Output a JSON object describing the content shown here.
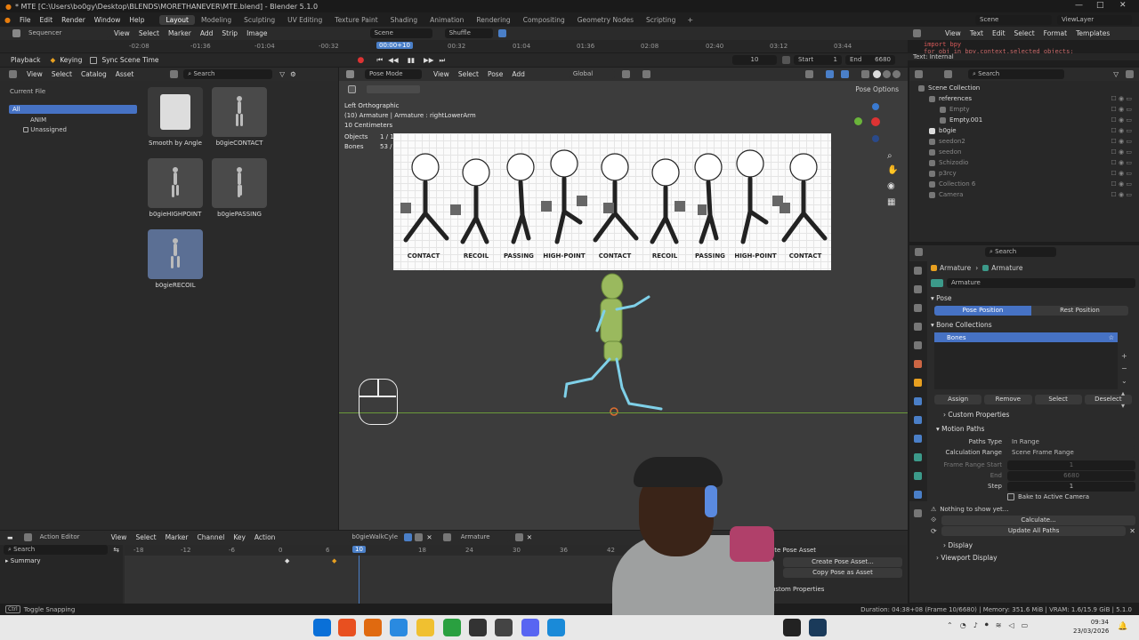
{
  "title": "* MTE [C:\\Users\\bo0gy\\Desktop\\BLENDS\\MORETHANEVER\\MTE.blend] - Blender 5.1.0",
  "menu": [
    "File",
    "Edit",
    "Render",
    "Window",
    "Help"
  ],
  "workspaces": [
    "Layout",
    "Modeling",
    "Sculpting",
    "UV Editing",
    "Texture Paint",
    "Shading",
    "Animation",
    "Rendering",
    "Compositing",
    "Geometry Nodes",
    "Scripting"
  ],
  "scene": "Scene",
  "view_layer": "ViewLayer",
  "sequencer": {
    "editor": "Sequencer",
    "menus": [
      "View",
      "Select",
      "Marker",
      "Add",
      "Strip",
      "Image"
    ],
    "scene": "Scene",
    "shuffle": "Shuffle",
    "times": [
      "-02:08",
      "-01:36",
      "-01:04",
      "-00:32",
      "00:00+10",
      "00:32",
      "01:04",
      "01:36",
      "02:08",
      "02:40",
      "03:12",
      "03:44"
    ]
  },
  "playback": {
    "playback": "Playback",
    "keying": "Keying",
    "sync": "Sync Scene Time",
    "frame": "10",
    "start_label": "Start",
    "start": "1",
    "end_label": "End",
    "end": "6680"
  },
  "text_editor": {
    "line1": "import bpy",
    "line2": "for obj in bpy.context.selected_objects:",
    "footer": "Text: Internal"
  },
  "asset_browser": {
    "menus": [
      "View",
      "Select",
      "Catalog",
      "Asset"
    ],
    "search": "Search",
    "library": "Current File",
    "catalogs": [
      "All",
      "ANIM",
      "Unassigned"
    ],
    "assets": [
      "Smooth by Angle",
      "b0gieCONTACT",
      "b0gieHIGHPOINT",
      "b0giePASSING",
      "b0gieRECOIL"
    ]
  },
  "viewport": {
    "mode": "Pose Mode",
    "menus": [
      "View",
      "Select",
      "Pose",
      "Add"
    ],
    "orientation": "Global",
    "pose_options": "Pose Options",
    "info1": "Left Orthographic",
    "info2": "(10) Armature | Armature : rightLowerArm",
    "info3": "10 Centimeters",
    "objects_label": "Objects",
    "objects_val": "1 / 1",
    "bones_label": "Bones",
    "bones_val": "53 / 55",
    "ref_labels": [
      "CONTACT",
      "RECOIL",
      "PASSING",
      "HIGH-POINT",
      "CONTACT",
      "RECOIL",
      "PASSING",
      "HIGH-POINT",
      "CONTACT"
    ]
  },
  "outliner": {
    "search": "Search",
    "items": [
      {
        "name": "Scene Collection",
        "indent": 0
      },
      {
        "name": "references",
        "indent": 1
      },
      {
        "name": "Empty",
        "indent": 2
      },
      {
        "name": "Empty.001",
        "indent": 2
      },
      {
        "name": "b0gie",
        "indent": 1
      },
      {
        "name": "seedon2",
        "indent": 1
      },
      {
        "name": "seedon",
        "indent": 1
      },
      {
        "name": "Schizodio",
        "indent": 1
      },
      {
        "name": "p3rcy",
        "indent": 1
      },
      {
        "name": "Collection 6",
        "indent": 1
      },
      {
        "name": "Camera",
        "indent": 1
      }
    ]
  },
  "properties": {
    "search": "Search",
    "crumb1": "Armature",
    "crumb2": "Armature",
    "data_name": "Armature",
    "pose": "Pose",
    "pose_position": "Pose Position",
    "rest_position": "Rest Position",
    "bone_collections": "Bone Collections",
    "bones": "Bones",
    "assign": "Assign",
    "remove": "Remove",
    "select": "Select",
    "deselect": "Deselect",
    "custom_properties": "Custom Properties",
    "motion_paths": "Motion Paths",
    "paths_type_label": "Paths Type",
    "paths_type": "In Range",
    "calc_range_label": "Calculation Range",
    "calc_range": "Scene Frame Range",
    "frs_label": "Frame Range Start",
    "frs": "1",
    "end_label": "End",
    "end": "6680",
    "step_label": "Step",
    "step": "1",
    "bake": "Bake to Active Camera",
    "nothing": "Nothing to show yet...",
    "calculate": "Calculate...",
    "update_all": "Update All Paths",
    "display": "Display",
    "viewport_display": "Viewport Display"
  },
  "action_editor": {
    "editor": "Action Editor",
    "menus": [
      "View",
      "Select",
      "Marker",
      "Channel",
      "Key",
      "Action"
    ],
    "action": "b0gieWalkCyle",
    "slot": "Armature",
    "search": "Search",
    "summary": "Summary",
    "ticks": [
      "-18",
      "-12",
      "-6",
      "0",
      "6",
      "10",
      "18",
      "24",
      "30",
      "36",
      "42"
    ],
    "create_pose": "Create Pose Asset",
    "create_pose2": "Create Pose Asset...",
    "copy_pose": "Copy Pose as Asset",
    "custom_props": "Custom Properties"
  },
  "status": {
    "left": "Toggle Snapping",
    "right": "Duration: 04:38+08 (Frame 10/6680) | Memory: 351.6 MiB | VRAM: 1.6/15.9 GiB | 5.1.0"
  },
  "taskbar": {
    "time": "09:34",
    "date": "23/03/2026"
  }
}
